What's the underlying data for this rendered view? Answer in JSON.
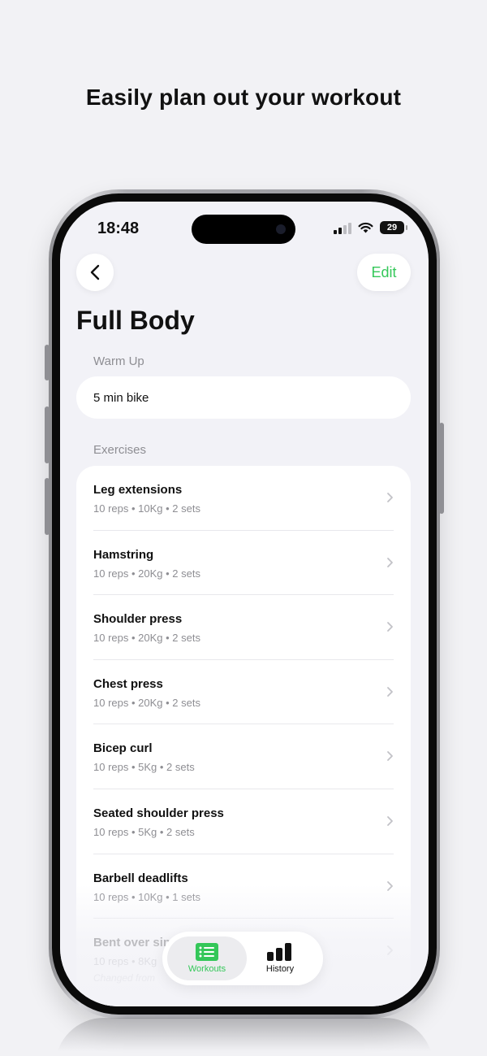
{
  "headline": "Easily plan out your workout",
  "status_bar": {
    "time": "18:48",
    "battery": "29"
  },
  "nav": {
    "edit_label": "Edit"
  },
  "page_title": "Full Body",
  "warm_up": {
    "label": "Warm Up",
    "value": "5 min bike"
  },
  "exercises": {
    "label": "Exercises",
    "items": [
      {
        "name": "Leg extensions",
        "meta": "10 reps • 10Kg • 2 sets"
      },
      {
        "name": "Hamstring",
        "meta": "10 reps • 20Kg • 2 sets"
      },
      {
        "name": "Shoulder press",
        "meta": "10 reps • 20Kg • 2 sets"
      },
      {
        "name": "Chest press",
        "meta": "10 reps • 20Kg • 2 sets"
      },
      {
        "name": "Bicep curl",
        "meta": "10 reps • 5Kg • 2 sets"
      },
      {
        "name": "Seated shoulder press",
        "meta": "10 reps • 5Kg • 2 sets"
      },
      {
        "name": "Barbell deadlifts",
        "meta": "10 reps • 10Kg • 1 sets"
      },
      {
        "name": "Bent over sin",
        "meta": "10 reps • 8Kg",
        "note": "Changed from"
      }
    ]
  },
  "tabbar": {
    "tabs": [
      {
        "label": "Workouts",
        "icon": "list-icon",
        "active": true
      },
      {
        "label": "History",
        "icon": "bar-chart-icon",
        "active": false
      }
    ]
  },
  "colors": {
    "accent": "#34c759",
    "background": "#f2f2f7",
    "secondary_text": "#8e8e93"
  }
}
